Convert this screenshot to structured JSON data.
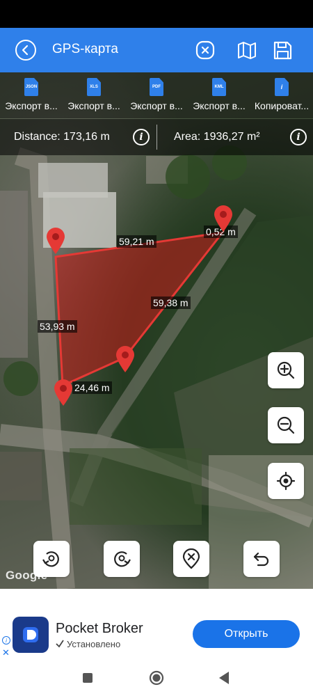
{
  "header": {
    "title": "GPS-карта",
    "accent": "#2f80ea"
  },
  "exports": [
    {
      "badge": "JSON",
      "label": "Экспорт в..."
    },
    {
      "badge": "XLS",
      "label": "Экспорт в..."
    },
    {
      "badge": "PDF",
      "label": "Экспорт в..."
    },
    {
      "badge": "KML",
      "label": "Экспорт в..."
    },
    {
      "badge": "i",
      "label": "Копироват..."
    }
  ],
  "measure": {
    "distance": "Distance: 173,16 m",
    "area": "Area: 1936,27 m²"
  },
  "segments": {
    "top": "59,21 m",
    "corner": "0,52 m",
    "diagonal": "59,38 m",
    "left": "53,93 m",
    "bottom": "24,46 m"
  },
  "map": {
    "attribution": "Google",
    "polygon_fill": "#b8201c",
    "pin_color": "#e53935"
  },
  "icons": {
    "back": "back-icon",
    "close": "close-circle-icon",
    "map": "map-icon",
    "save": "save-icon",
    "zoom_in": "zoom-in-icon",
    "zoom_out": "zoom-out-icon",
    "locate": "gps-locate-icon",
    "rotate_left": "rotate-left-icon",
    "rotate_right": "rotate-right-icon",
    "delete_point": "delete-point-icon",
    "undo": "undo-icon"
  },
  "ad": {
    "app_name": "Pocket Broker",
    "status": "Установлено",
    "button": "Открыть"
  }
}
